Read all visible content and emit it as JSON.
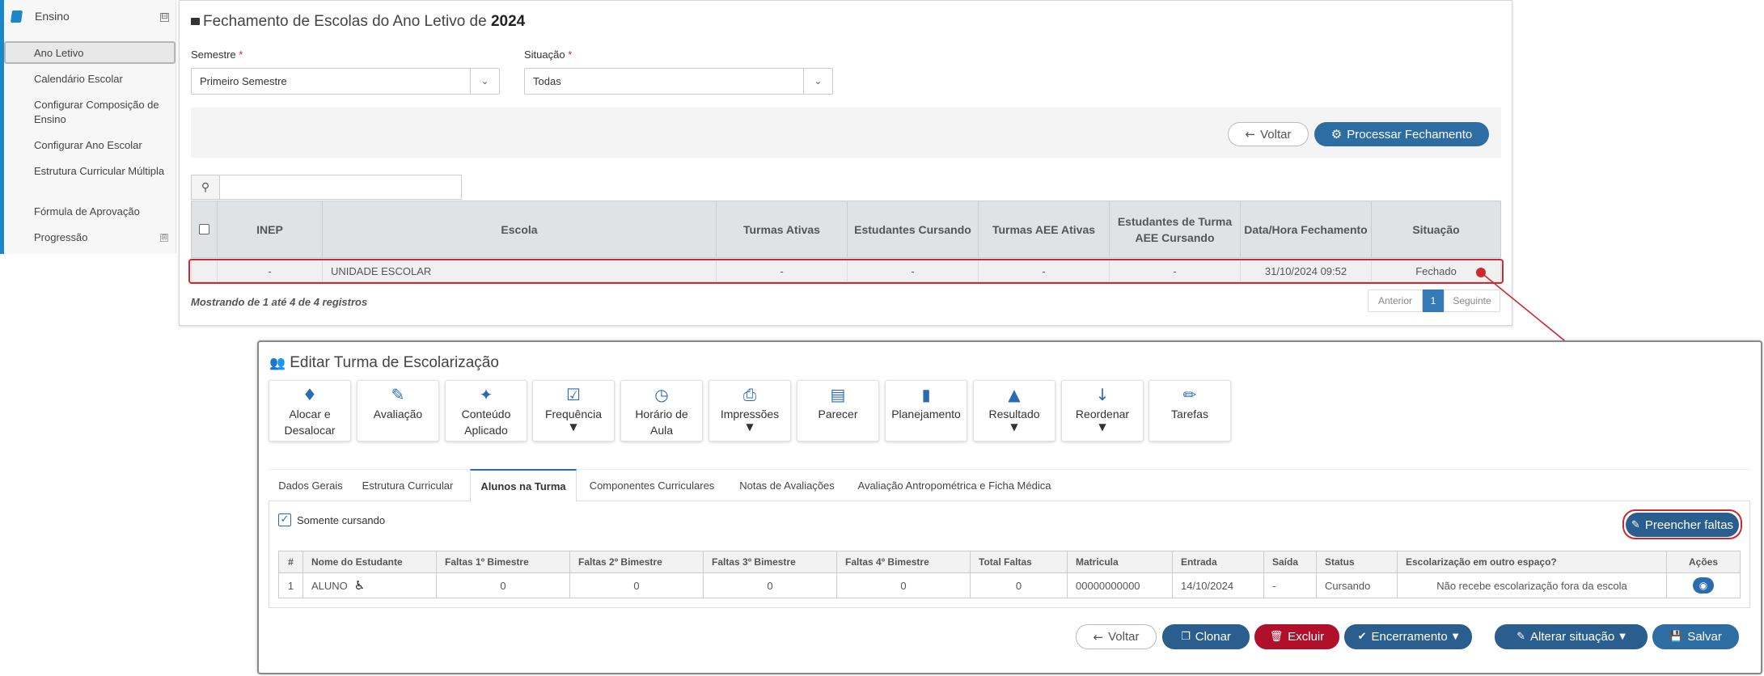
{
  "sidebar": {
    "section": "Ensino",
    "collapse_symbol": "⊟",
    "expand_symbol": "⊞",
    "items": [
      {
        "label": "Ano Letivo"
      },
      {
        "label": "Calendário Escolar"
      },
      {
        "label": "Configurar Composição de Ensino"
      },
      {
        "label": "Configurar Ano Escolar"
      },
      {
        "label": "Estrutura Curricular Múltipla"
      },
      {
        "label": "Fórmula de Aprovação"
      },
      {
        "label": "Progressão"
      }
    ]
  },
  "closing": {
    "title_prefix": "Fechamento de Escolas do Ano Letivo de",
    "year": "2024",
    "semestre": {
      "label": "Semestre",
      "required": "*",
      "value": "Primeiro Semestre"
    },
    "situacao": {
      "label": "Situação",
      "required": "*",
      "value": "Todas"
    },
    "back_label": "Voltar",
    "process_label": "Processar Fechamento",
    "search": {
      "value": ""
    },
    "table": {
      "headers": [
        "INEP",
        "Escola",
        "Turmas Ativas",
        "Estudantes Cursando",
        "Turmas AEE Ativas",
        "Estudantes de Turma AEE Cursando",
        "Data/Hora Fechamento",
        "Situação"
      ],
      "rows": [
        {
          "inep": "-",
          "escola": "UNIDADE ESCOLAR",
          "turmas_ativas": "-",
          "estudantes_cursando": "-",
          "turmas_aee": "-",
          "estudantes_aee": "-",
          "data_hora": "31/10/2024 09:52",
          "situacao": "Fechado"
        }
      ]
    },
    "info": "Mostrando de 1 até 4 de 4 registros",
    "pagination": {
      "prev": "Anterior",
      "current": "1",
      "next": "Seguinte"
    }
  },
  "turma": {
    "title": "Editar Turma de Escolarização",
    "tiles": [
      {
        "label": "Alocar e Desalocar",
        "icon": "puzzle-icon"
      },
      {
        "label": "Avaliação",
        "icon": "edit-icon"
      },
      {
        "label": "Conteúdo Aplicado",
        "icon": "magic-wand-icon"
      },
      {
        "label": "Frequência",
        "icon": "check-square-icon"
      },
      {
        "label": "Horário de Aula",
        "icon": "clock-icon"
      },
      {
        "label": "Impressões",
        "icon": "print-icon"
      },
      {
        "label": "Parecer",
        "icon": "document-icon"
      },
      {
        "label": "Planejamento",
        "icon": "book-icon"
      },
      {
        "label": "Resultado",
        "icon": "graduation-cap-icon"
      },
      {
        "label": "Reordenar",
        "icon": "sort-alpha-icon"
      },
      {
        "label": "Tarefas",
        "icon": "pencil-icon"
      }
    ],
    "tabs": [
      "Dados Gerais",
      "Estrutura Curricular",
      "Alunos na Turma",
      "Componentes Curriculares",
      "Notas de Avaliações",
      "Avaliação Antropométrica e Ficha Médica"
    ],
    "active_tab": "Alunos na Turma",
    "somente_cursando": "Somente cursando",
    "fill_absences_label": "Preencher faltas",
    "students": {
      "headers": [
        "#",
        "Nome do Estudante",
        "Faltas 1º Bimestre",
        "Faltas 2º Bimestre",
        "Faltas 3º Bimestre",
        "Faltas 4º Bimestre",
        "Total Faltas",
        "Matricula",
        "Entrada",
        "Saída",
        "Status",
        "Escolarização em outro espaço?",
        "Ações"
      ],
      "rows": [
        {
          "num": "1",
          "nome": "ALUNO",
          "f1": "0",
          "f2": "0",
          "f3": "0",
          "f4": "0",
          "total": "0",
          "matricula": "00000000000",
          "entrada": "14/10/2024",
          "saida": "-",
          "status": "Cursando",
          "escolarizacao": "Não recebe escolarização fora da escola"
        }
      ]
    },
    "actions": {
      "voltar": "Voltar",
      "clonar": "Clonar",
      "excluir": "Excluir",
      "encerramento": "Encerramento",
      "alterar": "Alterar situação",
      "salvar": "Salvar"
    }
  },
  "colors": {
    "accent": "#2b6bb0",
    "primary_button": "#2e6da4",
    "dark_button": "#2a5e8e",
    "danger": "#b0102a",
    "highlight": "#d0282e"
  }
}
